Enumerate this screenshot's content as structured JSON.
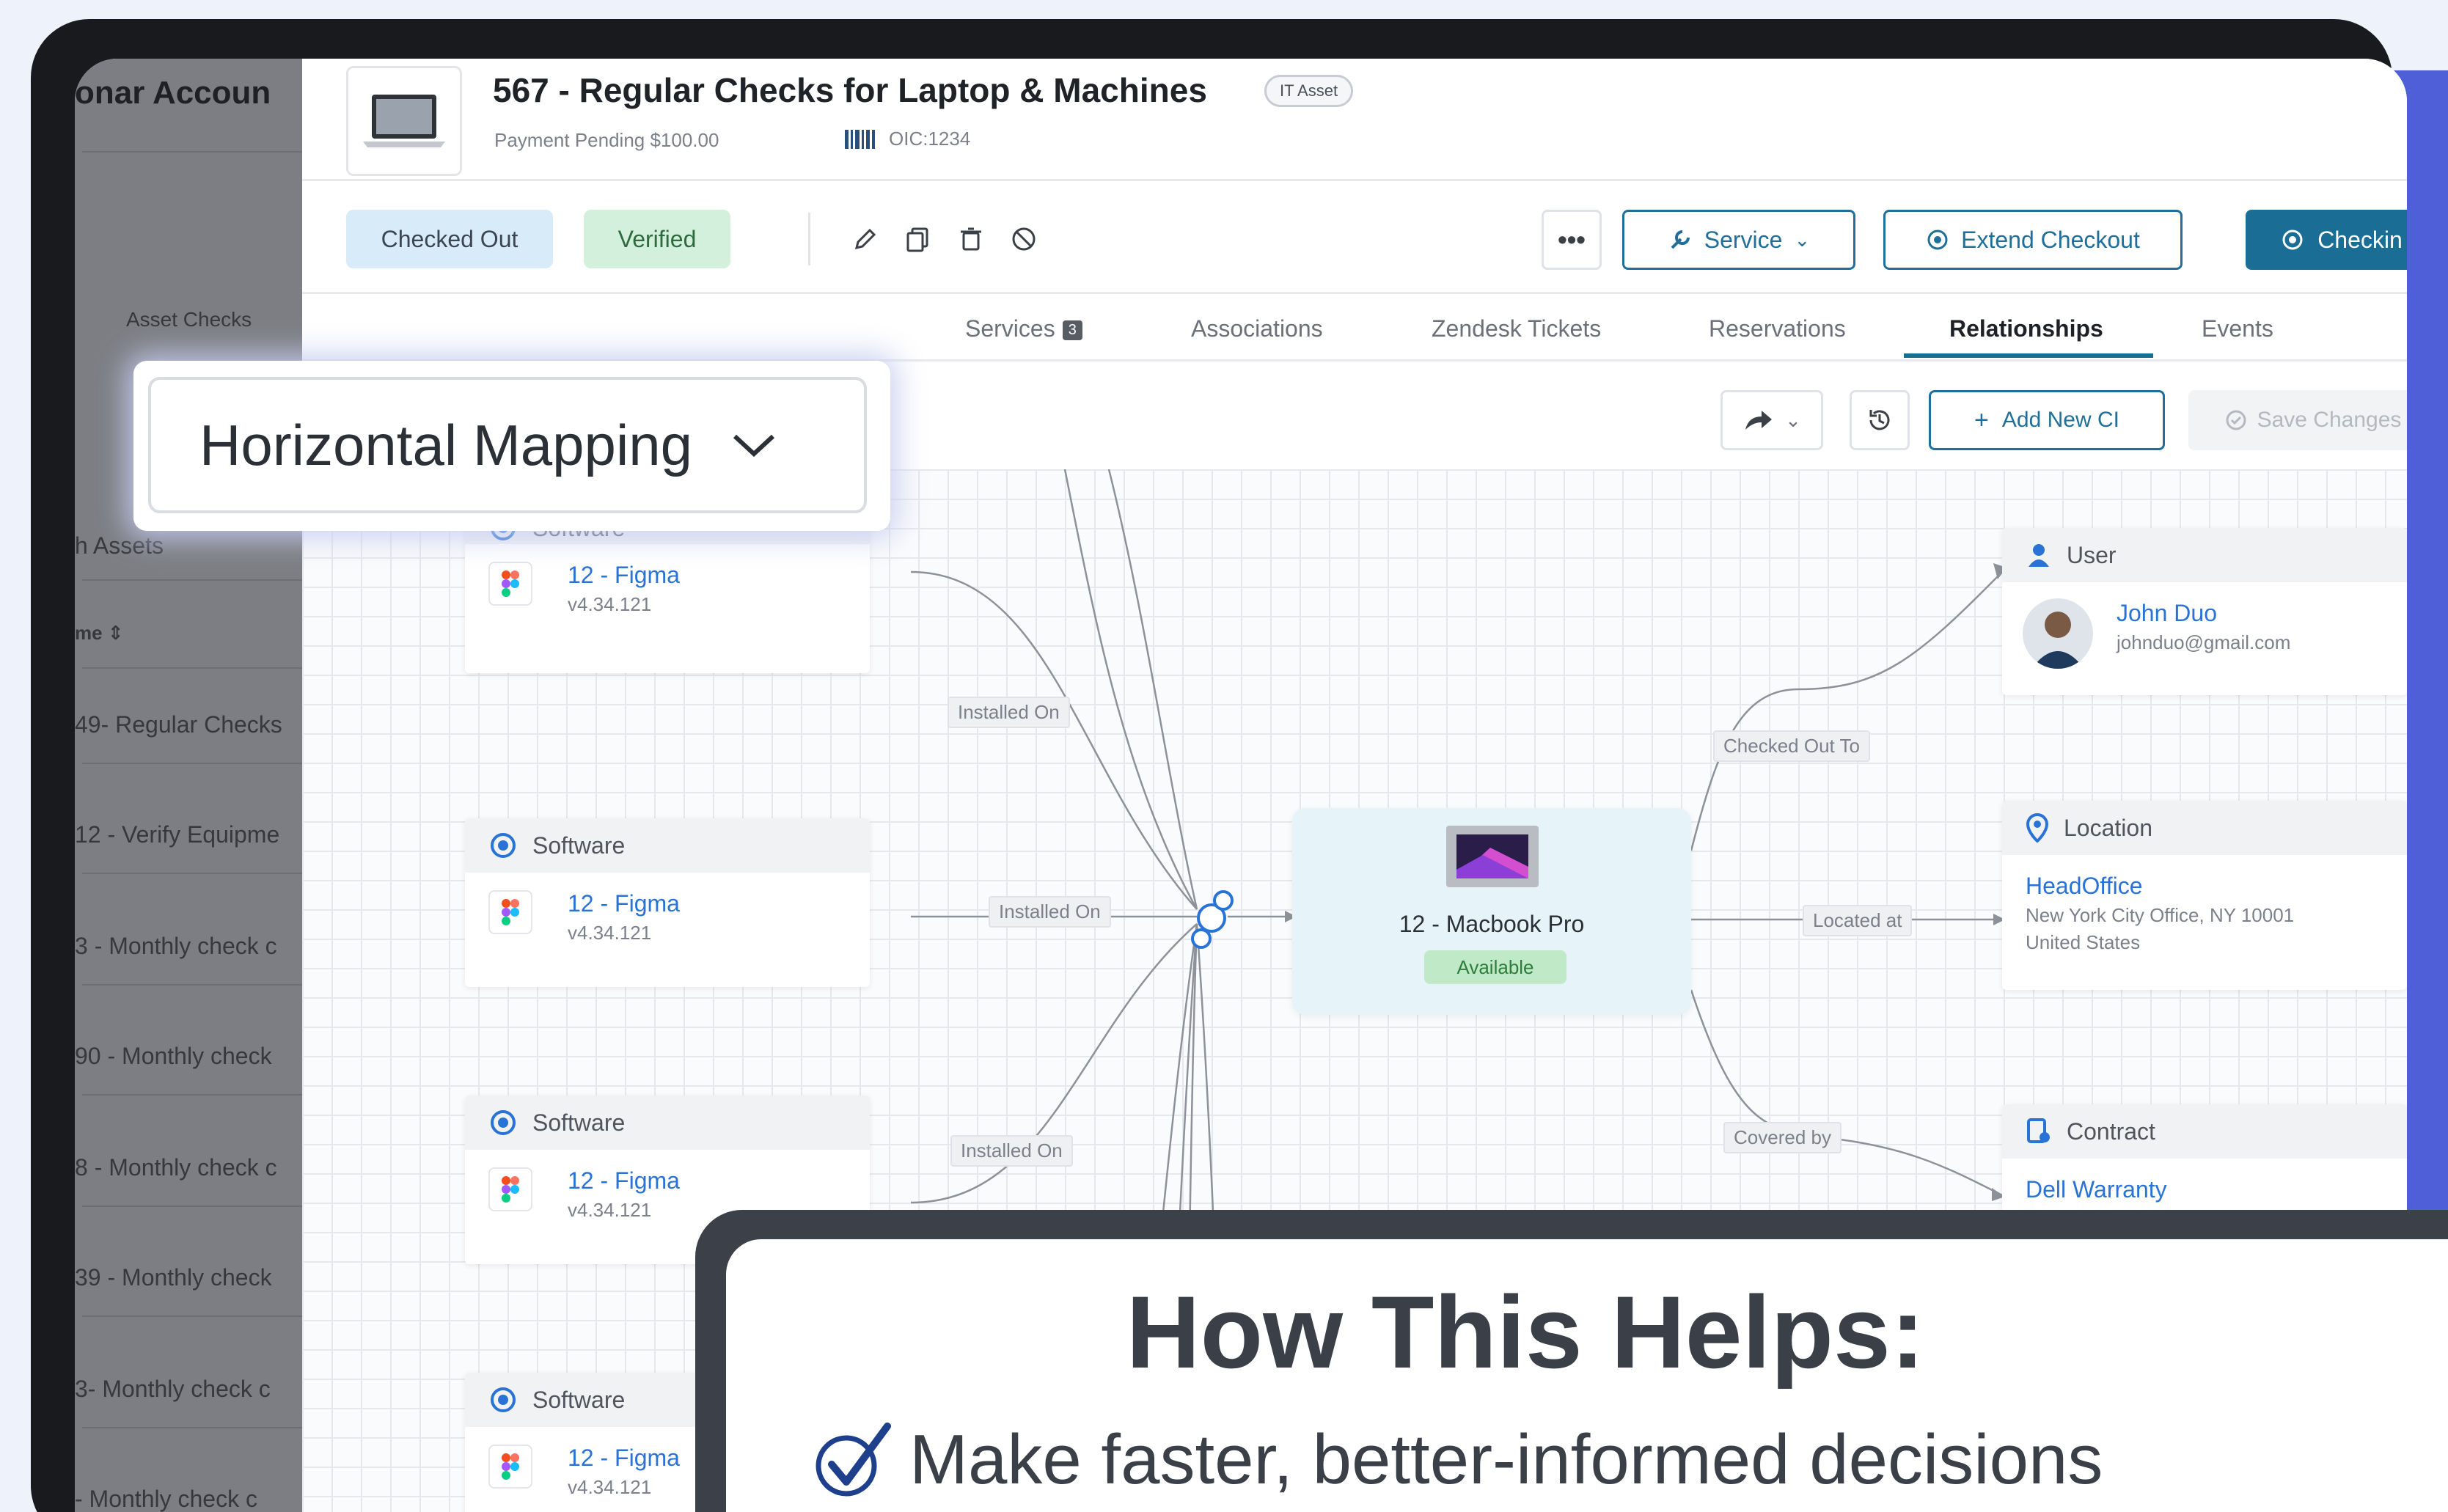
{
  "sidebar": {
    "header": "onar Accoun",
    "items": [
      {
        "label": "Asset Checks",
        "y": 0
      },
      {
        "label": "h Assets"
      },
      {
        "label": "me ⇕"
      },
      {
        "label": "49- Regular Checks"
      },
      {
        "label": "12 - Verify Equipme"
      },
      {
        "label": "3 - Monthly check c"
      },
      {
        "label": "90 - Monthly check"
      },
      {
        "label": "8 - Monthly check c"
      },
      {
        "label": "39 - Monthly check"
      },
      {
        "label": "3- Monthly check c"
      },
      {
        "label": "- Monthly check c"
      }
    ]
  },
  "header": {
    "title": "567 - Regular Checks for Laptop & Machines",
    "tag": "IT Asset",
    "payment": "Payment Pending $100.00",
    "oic": "OIC:1234"
  },
  "toolbar": {
    "status_checked_out": "Checked Out",
    "status_verified": "Verified",
    "more": "•••",
    "service": "Service",
    "extend_checkout": "Extend Checkout",
    "checkin": "Checkin"
  },
  "tabs": {
    "services": "Services",
    "services_count": "3",
    "associations": "Associations",
    "zendesk": "Zendesk Tickets",
    "reservations": "Reservations",
    "relationships": "Relationships",
    "events": "Events"
  },
  "canvas_toolbar": {
    "add_new_ci": "Add New CI",
    "save_changes": "Save Changes"
  },
  "mapping_dropdown": {
    "selected": "Horizontal Mapping"
  },
  "software_cards": [
    {
      "header": "Software",
      "name": "12 - Figma",
      "version": "v4.34.121"
    },
    {
      "header": "Software",
      "name": "12 - Figma",
      "version": "v4.34.121"
    },
    {
      "header": "Software",
      "name": "12 - Figma",
      "version": "v4.34.121"
    },
    {
      "header": "Software",
      "name": "12 - Figma",
      "version": "v4.34.121"
    }
  ],
  "edge_labels": {
    "installed_on_1": "Installed On",
    "installed_on_2": "Installed On",
    "installed_on_3": "Installed On",
    "checked_out_to": "Checked Out To",
    "located_at": "Located at",
    "covered_by": "Covered by"
  },
  "center_node": {
    "name": "12 - Macbook Pro",
    "status": "Available"
  },
  "user_card": {
    "header": "User",
    "name": "John Duo",
    "email": "johnduo@gmail.com"
  },
  "location_card": {
    "header": "Location",
    "name": "HeadOffice",
    "address1": "New York City Office, NY 10001",
    "address2": "United States"
  },
  "contract_card": {
    "header": "Contract",
    "name": "Dell Warranty"
  },
  "help_panel": {
    "title": "How This Helps:",
    "point": "Make faster, better-informed decisions"
  },
  "colors": {
    "accent": "#1a6d94",
    "link": "#2a73d6",
    "side_bar": "#4f5fd8",
    "verified_bg": "#d3f0dc",
    "checked_out_bg": "#d7ecf8",
    "available_bg": "#bfe9c7"
  }
}
